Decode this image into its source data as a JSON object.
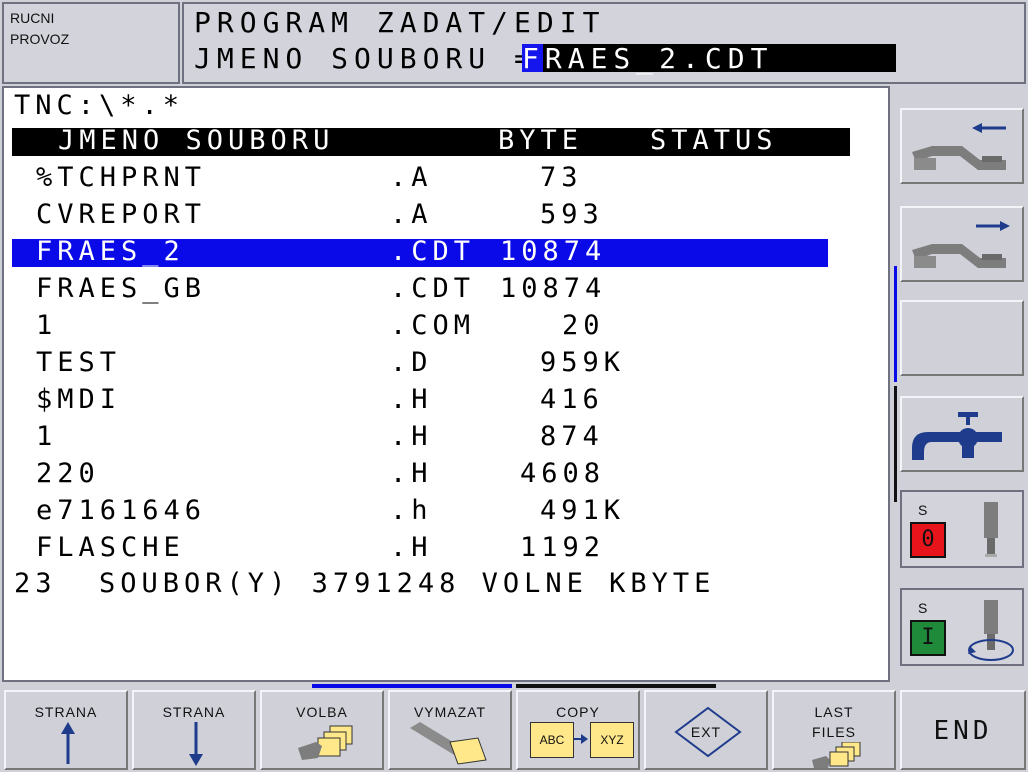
{
  "mode": {
    "line1": "RUCNI",
    "line2": "PROVOZ"
  },
  "title": {
    "line1": "PROGRAM ZADAT/EDIT",
    "prefix": "JMENO SOUBORU =",
    "filename": "FRAES_2.CDT"
  },
  "path": "TNC:\\*.*",
  "table": {
    "headers": {
      "name": "JMENO SOUBORU",
      "byte": "BYTE",
      "status": "STATUS"
    },
    "rows": [
      {
        "name": "%TCHPRNT",
        "ext": ".A",
        "size": "73"
      },
      {
        "name": "CVREPORT",
        "ext": ".A",
        "size": "593"
      },
      {
        "name": "FRAES_2",
        "ext": ".CDT",
        "size": "10874"
      },
      {
        "name": "FRAES_GB",
        "ext": ".CDT",
        "size": "10874"
      },
      {
        "name": "1",
        "ext": ".COM",
        "size": "20"
      },
      {
        "name": "TEST",
        "ext": ".D",
        "size": "959K"
      },
      {
        "name": "$MDI",
        "ext": ".H",
        "size": "416"
      },
      {
        "name": "1",
        "ext": ".H",
        "size": "874"
      },
      {
        "name": "220",
        "ext": ".H",
        "size": "4608"
      },
      {
        "name": "e7161646",
        "ext": ".h",
        "size": "491K"
      },
      {
        "name": "FLASCHE",
        "ext": ".H",
        "size": "1192"
      }
    ],
    "selected_index": 2
  },
  "summary": "23  SOUBOR(Y) 3791248 VOLNE KBYTE",
  "right_softkeys": {
    "spindle1": {
      "label": "S",
      "value": "0",
      "color": "#e8141c"
    },
    "spindle2": {
      "label": "S",
      "value": "I",
      "color": "#1e8a3a"
    }
  },
  "bottom_softkeys": {
    "strana_up": "STRANA",
    "strana_down": "STRANA",
    "volba": "VOLBA",
    "vymazat": "VYMAZAT",
    "copy": "COPY",
    "copy_from": "ABC",
    "copy_to": "XYZ",
    "ext": "EXT",
    "last1": "LAST",
    "last2": "FILES",
    "end": "END"
  },
  "colors": {
    "selection": "#0a0ae8",
    "header": "#000000",
    "icon_gray": "#7d7d7d",
    "icon_blue": "#1f3c8c",
    "icon_yellow": "#ffe88a"
  }
}
